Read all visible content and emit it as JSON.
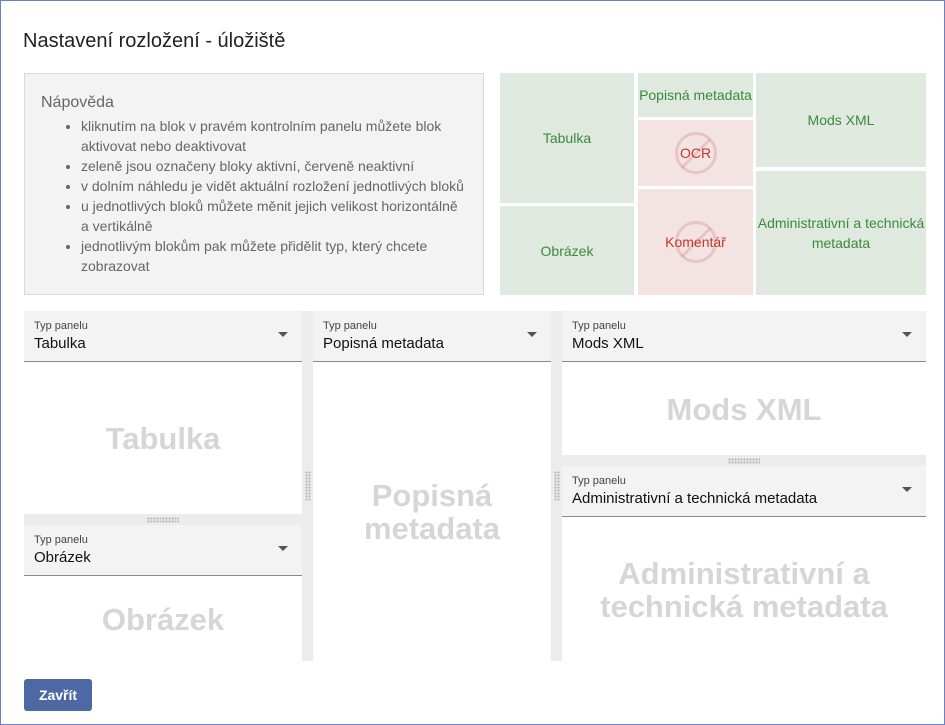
{
  "dialog": {
    "title": "Nastavení rozložení - úložiště"
  },
  "help": {
    "title": "Nápověda",
    "items": [
      "kliknutím na blok v pravém kontrolním panelu můžete blok aktivovat nebo deaktivovat",
      "zeleně jsou označeny bloky aktivní, červeně neaktivní",
      "v dolním náhledu je vidět aktuální rozložení jednotlivých bloků",
      "u jednotlivých bloků můžete měnit jejich velikost horizontálně a vertikálně",
      "jednotlivým blokům pak můžete přidělit typ, který chcete zobrazovat"
    ]
  },
  "control_blocks": {
    "tabulka": {
      "label": "Tabulka",
      "state": "active"
    },
    "obrazek": {
      "label": "Obrázek",
      "state": "active"
    },
    "popisna": {
      "label": "Popisná metadata",
      "state": "active"
    },
    "ocr": {
      "label": "OCR",
      "state": "inactive"
    },
    "komentar": {
      "label": "Komentář",
      "state": "inactive"
    },
    "mods": {
      "label": "Mods XML",
      "state": "active"
    },
    "admin": {
      "label": "Administrativní a technická metadata",
      "state": "active"
    }
  },
  "panels": {
    "tabulka": {
      "select_label": "Typ panelu",
      "select_value": "Tabulka",
      "watermark": "Tabulka"
    },
    "obrazek": {
      "select_label": "Typ panelu",
      "select_value": "Obrázek",
      "watermark": "Obrázek"
    },
    "popisna": {
      "select_label": "Typ panelu",
      "select_value": "Popisná metadata",
      "watermark": "Popisná metadata"
    },
    "mods": {
      "select_label": "Typ panelu",
      "select_value": "Mods XML",
      "watermark": "Mods XML"
    },
    "admin": {
      "select_label": "Typ panelu",
      "select_value": "Administrativní a technická metadata",
      "watermark": "Administrativní a technická metadata"
    }
  },
  "footer": {
    "close_label": "Zavřít"
  },
  "colors": {
    "active_bg": "#dfe9df",
    "active_text": "#3b8a3b",
    "inactive_bg": "#f4e3e3",
    "inactive_text": "#c0392b",
    "primary_button": "#4d68a3"
  },
  "icons": {
    "inactive_marker": "ban-icon",
    "dropdown": "chevron-down-icon"
  }
}
